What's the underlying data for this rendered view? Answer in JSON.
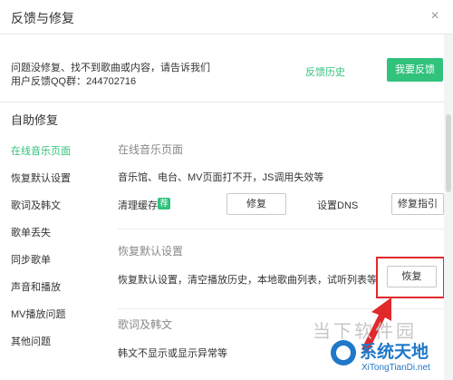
{
  "window": {
    "title": "反馈与修复",
    "close_glyph": "×"
  },
  "feedback": {
    "line1": "问题没修复、找不到歌曲或内容，请告诉我们",
    "line2": "用户反馈QQ群：244702716",
    "history_link": "反馈历史",
    "feedback_button": "我要反馈"
  },
  "self_repair": {
    "title": "自助修复",
    "nav": [
      {
        "label": "在线音乐页面",
        "active": true
      },
      {
        "label": "恢复默认设置",
        "active": false
      },
      {
        "label": "歌词及韩文",
        "active": false
      },
      {
        "label": "歌单丢失",
        "active": false
      },
      {
        "label": "同步歌单",
        "active": false
      },
      {
        "label": "声音和播放",
        "active": false
      },
      {
        "label": "MV播放问题",
        "active": false
      },
      {
        "label": "其他问题",
        "active": false
      }
    ],
    "groups": {
      "online": {
        "heading": "在线音乐页面",
        "desc": "音乐馆、电台、MV页面打不开，JS调用失效等",
        "clear_cache_label": "清理缓存",
        "recommend_badge": "荐",
        "repair_button": "修复",
        "dns_label": "设置DNS",
        "guide_button": "修复指引"
      },
      "defaults": {
        "heading": "恢复默认设置",
        "desc": "恢复默认设置，清空播放历史，本地歌曲列表，试听列表等",
        "restore_button": "恢复"
      },
      "lyrics": {
        "heading": "歌词及韩文",
        "desc": "韩文不显示或显示异常等"
      }
    }
  },
  "watermark": {
    "cn_text": "当下软件园",
    "name": "系统天地",
    "url": "XiTongTianDi.net"
  },
  "colors": {
    "accent": "#31c27c",
    "highlight": "#e0292b",
    "watermark_blue": "#1f78c8"
  },
  "icons": {
    "close": "close-icon",
    "arrow": "red-arrow-icon"
  }
}
